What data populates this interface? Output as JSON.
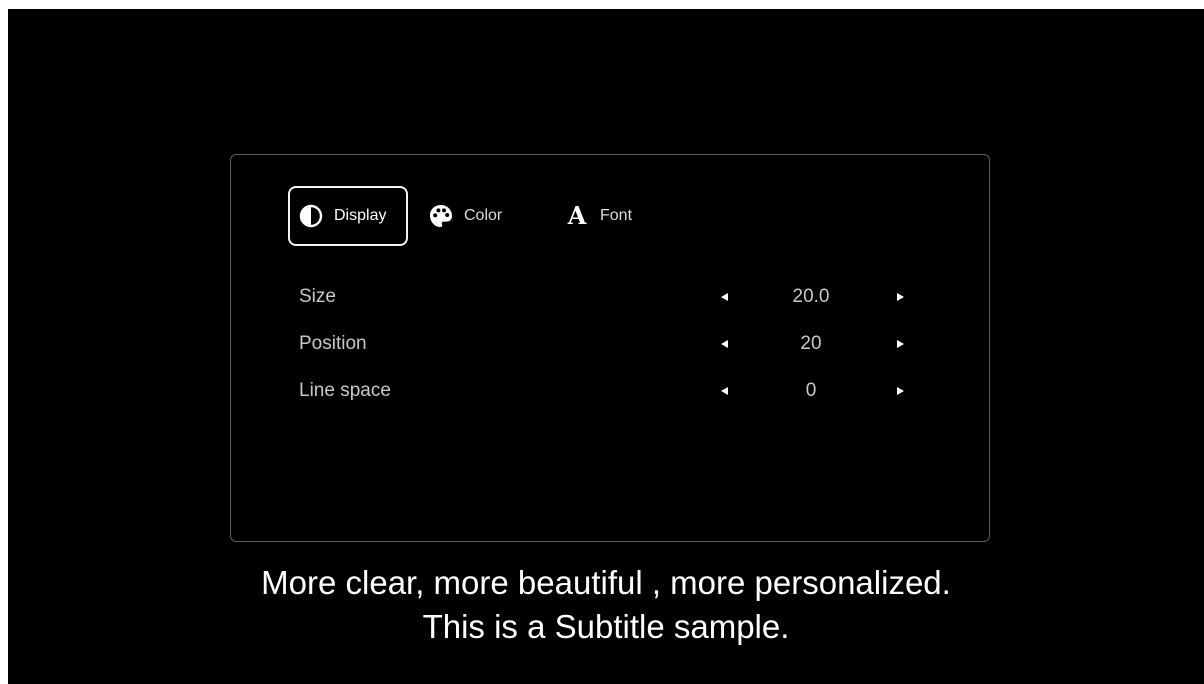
{
  "tabs": [
    {
      "label": "Display",
      "icon": "contrast-icon",
      "active": true
    },
    {
      "label": "Color",
      "icon": "palette-icon",
      "active": false
    },
    {
      "label": "Font",
      "icon": "font-icon",
      "glyph": "A",
      "active": false
    }
  ],
  "settings": [
    {
      "label": "Size",
      "value": "20.0"
    },
    {
      "label": "Position",
      "value": "20"
    },
    {
      "label": "Line space",
      "value": "0"
    }
  ],
  "subtitle": {
    "line1": "More clear, more beautiful , more personalized.",
    "line2": "This is a Subtitle sample."
  },
  "colors": {
    "background": "#000000",
    "panel_border": "#5f5f5f",
    "text_primary": "#ffffff",
    "text_secondary": "#c8c8c8"
  }
}
